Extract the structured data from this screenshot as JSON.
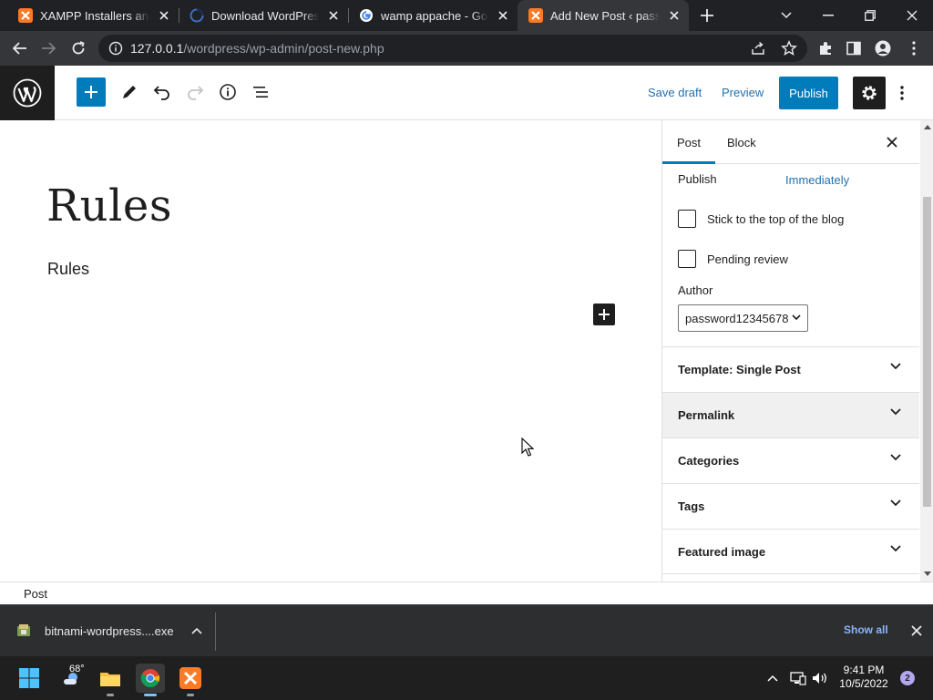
{
  "browser": {
    "tabs": [
      {
        "title": "XAMPP Installers and Downloads",
        "icon": "xampp-icon",
        "active": false
      },
      {
        "title": "Download WordPress packages",
        "icon": "wordpress-icon",
        "active": false
      },
      {
        "title": "wamp appache - Google Search",
        "icon": "google-icon",
        "active": false
      },
      {
        "title": "Add New Post ‹ password",
        "icon": "xampp-icon",
        "active": true
      }
    ],
    "url_host": "127.0.0.1",
    "url_path": "/wordpress/wp-admin/post-new.php"
  },
  "editor": {
    "save_draft": "Save draft",
    "preview": "Preview",
    "publish": "Publish"
  },
  "post": {
    "title": "Rules",
    "paragraph": "Rules"
  },
  "sidebar": {
    "tabs": [
      "Post",
      "Block"
    ],
    "active_tab": "Post",
    "publish_label": "Publish",
    "publish_value": "Immediately",
    "sticky_label": "Stick to the top of the blog",
    "pending_label": "Pending review",
    "author_label": "Author",
    "author_value": "password12345678",
    "panels": [
      "Template: Single Post",
      "Permalink",
      "Categories",
      "Tags",
      "Featured image"
    ]
  },
  "footer": {
    "breadcrumb": "Post"
  },
  "downloads": {
    "file": "bitnami-wordpress....exe",
    "show_all": "Show all"
  },
  "taskbar": {
    "weather": "68°",
    "time": "9:41 PM",
    "date": "10/5/2022",
    "notifications": "2"
  },
  "colors": {
    "accent": "#007cba",
    "link": "#2271b1",
    "dark": "#1e1e1e",
    "chrome_bg": "#202124"
  }
}
